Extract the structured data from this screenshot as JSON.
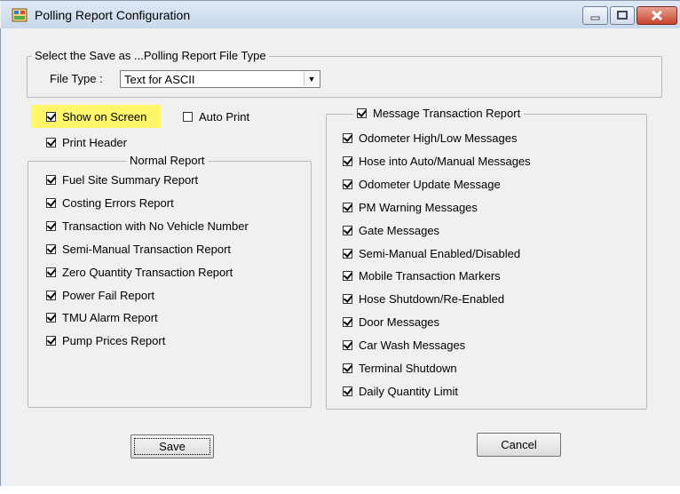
{
  "window": {
    "title": "Polling Report Configuration"
  },
  "file_type_group": {
    "legend": "Select the Save as ...Polling Report File Type",
    "label": "File Type :",
    "selected": "Text for ASCII"
  },
  "options": {
    "show_on_screen": "Show on Screen",
    "auto_print": "Auto Print",
    "print_header": "Print Header"
  },
  "normal_report": {
    "legend": "Normal Report",
    "items": [
      "Fuel Site Summary Report",
      "Costing Errors Report",
      "Transaction with No Vehicle Number",
      "Semi-Manual Transaction Report",
      "Zero Quantity Transaction Report",
      "Power Fail Report",
      "TMU Alarm Report",
      "Pump Prices Report"
    ]
  },
  "message_report": {
    "legend": "Message Transaction Report",
    "items": [
      "Odometer High/Low Messages",
      "Hose into Auto/Manual Messages",
      "Odometer Update Message",
      "PM Warning Messages",
      "Gate Messages",
      "Semi-Manual Enabled/Disabled",
      "Mobile Transaction Markers",
      "Hose Shutdown/Re-Enabled",
      "Door Messages",
      "Car Wash Messages",
      "Terminal Shutdown",
      "Daily Quantity Limit"
    ]
  },
  "buttons": {
    "save": "Save",
    "cancel": "Cancel"
  },
  "colors": {
    "highlight": "#fff66a",
    "close_button": "#c7442d"
  }
}
